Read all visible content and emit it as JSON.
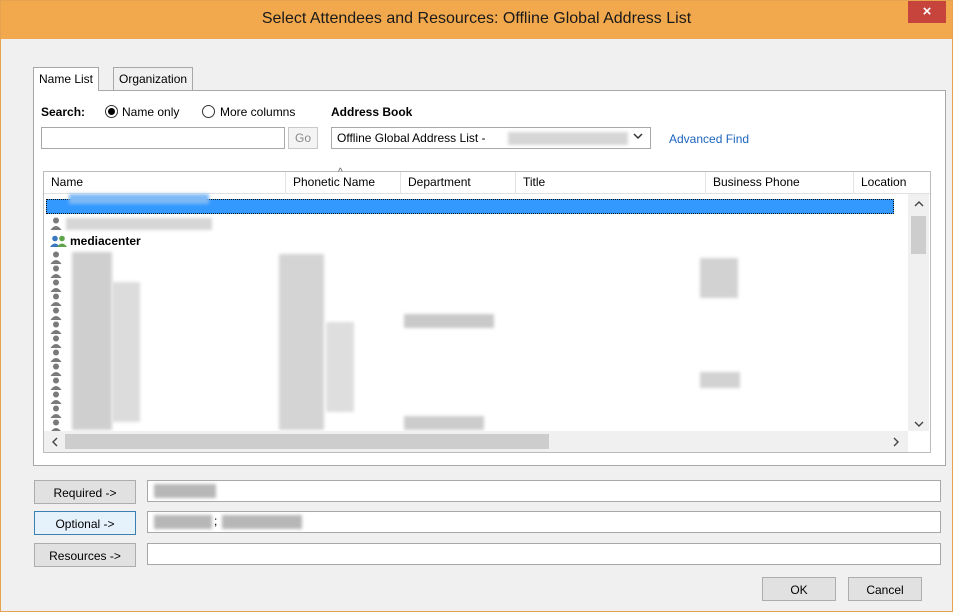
{
  "window": {
    "title": "Select Attendees and Resources: Offline Global Address List",
    "close_glyph": "×"
  },
  "tabs": [
    {
      "label": "Name List",
      "active": true
    },
    {
      "label": "Organization",
      "active": false
    }
  ],
  "search": {
    "label": "Search:",
    "option_name_only": "Name only",
    "option_more_columns": "More columns",
    "selected": "Name only",
    "input_value": "",
    "go_label": "Go"
  },
  "address_book": {
    "label": "Address Book",
    "selected": "Offline Global Address List -",
    "advanced_find": "Advanced Find"
  },
  "list": {
    "columns": [
      "Name",
      "Phonetic Name",
      "Department",
      "Title",
      "Business Phone",
      "Location"
    ],
    "sort_indicator": "^",
    "visible_named_entry": "mediacenter"
  },
  "recipients": {
    "required_label": "Required ->",
    "optional_label": "Optional ->",
    "resources_label": "Resources ->",
    "optional_separator": ";"
  },
  "footer": {
    "ok_label": "OK",
    "cancel_label": "Cancel"
  },
  "icons": {
    "close": "close-icon",
    "person": "person-icon",
    "group": "distribution-list-icon",
    "dropdown": "chevron-down-icon"
  },
  "colors": {
    "titlebar": "#f2a94e",
    "selection": "#3399ff",
    "link": "#1d64bf",
    "close_button": "#c7443d"
  }
}
